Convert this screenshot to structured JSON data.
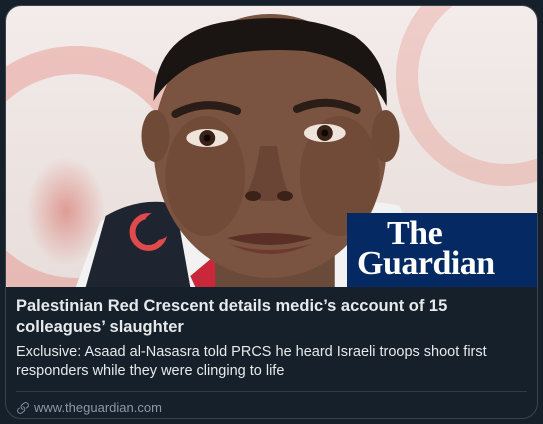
{
  "card": {
    "title": "Palestinian Red Crescent details medic’s account of 15 colleagues’ slaughter",
    "description": "Exclusive: Asaad al-Nasasra told PRCS he heard Israeli troops shoot first responders while they were clinging to life",
    "domain": "www.theguardian.com"
  },
  "logo": {
    "line1": "The",
    "line2": "Guardian"
  },
  "colors": {
    "background": "#15202b",
    "border": "#38444d",
    "title_text": "#e7e9ea",
    "muted_text": "#8b98a5",
    "guardian_blue": "#052962",
    "crescent_red": "#e04a4a"
  },
  "icons": [
    "link-icon"
  ]
}
